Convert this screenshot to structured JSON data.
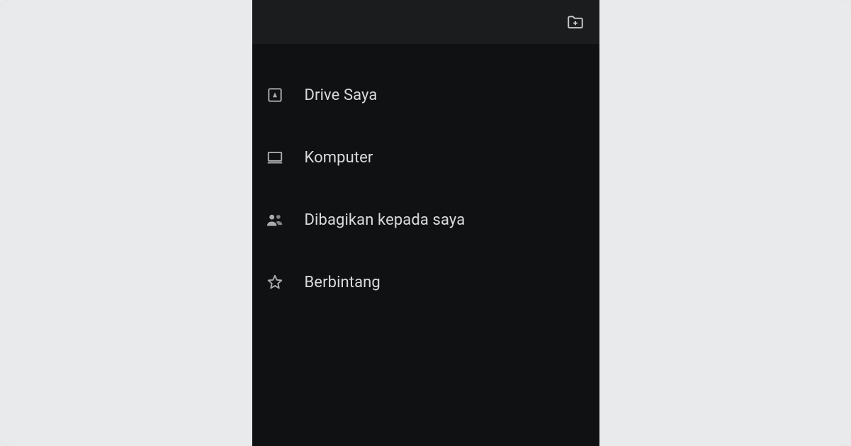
{
  "topbar": {
    "new_folder_icon": "new-folder-icon"
  },
  "nav": {
    "items": [
      {
        "icon": "drive-icon",
        "label": "Drive Saya"
      },
      {
        "icon": "computer-icon",
        "label": "Komputer"
      },
      {
        "icon": "shared-icon",
        "label": "Dibagikan kepada saya"
      },
      {
        "icon": "star-icon",
        "label": "Berbintang"
      }
    ]
  }
}
